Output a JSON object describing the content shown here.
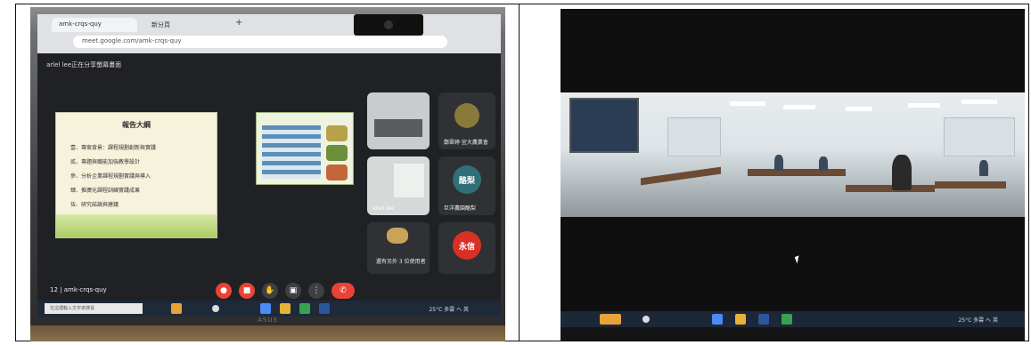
{
  "left_photo": {
    "browser": {
      "tabs": [
        "amk-crqs-quy",
        "新分頁"
      ],
      "url": "meet.google.com/amk-crqs-quy"
    },
    "meeting_title": "arlel lee正在分享螢幕畫面",
    "slide": {
      "title": "報告大綱",
      "lines": [
        "壹、專案背景：課程規劃創新與實踐",
        "貳、專題與職能加強教學設計",
        "參、分析企業課程規劃實踐與導入",
        "肆、推廣化課程訓練實踐成果",
        "伍、研究結論與建議"
      ]
    },
    "participants": [
      {
        "label": "arlel lee"
      },
      {
        "label": "鄭翠婷‧宜大農業會",
        "initials": ""
      },
      {
        "label": "巨洋農園酪梨",
        "initials": "酪梨"
      },
      {
        "label": "還有另外 3 位使用者",
        "initials": ""
      },
      {
        "label": "",
        "initials": "永信"
      }
    ],
    "meeting_code": "12 | amk-crqs-quy",
    "taskbar": {
      "search_placeholder": "在這裡輸入文字來搜尋",
      "status": "25°C 多雲  へ 英"
    },
    "monitor_brand": "ASUS"
  },
  "right_photo": {
    "taskbar": {
      "status": "25°C 多雲  へ 英"
    }
  },
  "colors": {
    "meet_dark": "#202124",
    "end_call_red": "#ea4335",
    "avatar_teal": "#2f6f77",
    "avatar_red": "#d93025"
  }
}
